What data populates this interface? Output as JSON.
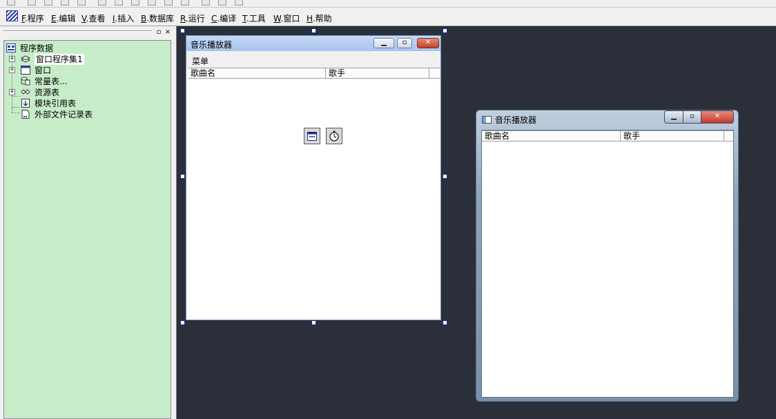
{
  "menubar": {
    "items": [
      {
        "key": "F",
        "label": ".程序"
      },
      {
        "key": "E",
        "label": ".编辑"
      },
      {
        "key": "V",
        "label": ".查看"
      },
      {
        "key": "I",
        "label": ".插入"
      },
      {
        "key": "B",
        "label": ".数据库"
      },
      {
        "key": "R",
        "label": ".运行"
      },
      {
        "key": "C",
        "label": ".编译"
      },
      {
        "key": "T",
        "label": ".工具"
      },
      {
        "key": "W",
        "label": ".窗口"
      },
      {
        "key": "H",
        "label": ".帮助"
      }
    ]
  },
  "tree": {
    "root": "程序数据",
    "items": [
      {
        "label": "窗口程序集1",
        "icon": "assembly-icon"
      },
      {
        "label": "窗口",
        "icon": "window-icon"
      },
      {
        "label": "常量表...",
        "icon": "constant-table-icon"
      },
      {
        "label": "资源表",
        "icon": "resource-table-icon"
      },
      {
        "label": "模块引用表",
        "icon": "module-reference-icon"
      },
      {
        "label": "外部文件记录表",
        "icon": "external-file-icon"
      }
    ]
  },
  "design_window": {
    "title": "音乐播放器",
    "menu_label": "菜单",
    "columns": [
      "歌曲名",
      "歌手"
    ]
  },
  "preview_window": {
    "title": "音乐播放器",
    "columns": [
      "歌曲名",
      "歌手"
    ]
  },
  "colors": {
    "tree_background": "#c6ecc8",
    "workspace_background": "#2b2f3a",
    "close_button": "#c0432b"
  }
}
